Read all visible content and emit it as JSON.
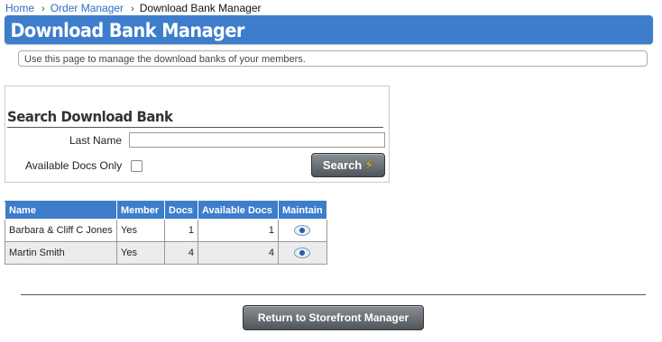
{
  "breadcrumb": {
    "home": "Home",
    "order_manager": "Order Manager",
    "current": "Download Bank Manager"
  },
  "header": {
    "title": "Download Bank Manager"
  },
  "info": {
    "text": "Use this page to manage the download banks of your members."
  },
  "search": {
    "title": "Search Download Bank",
    "last_name_label": "Last Name",
    "last_name_value": "",
    "available_docs_label": "Available Docs Only",
    "available_docs_checked": false,
    "button_label": "Search",
    "button_icon": "lightning-icon"
  },
  "table": {
    "headers": [
      "Name",
      "Member",
      "Docs",
      "Available Docs",
      "Maintain"
    ],
    "rows": [
      {
        "name": "Barbara & Cliff C Jones",
        "member": "Yes",
        "docs": "1",
        "available_docs": "1",
        "maintain_icon": "eye-icon"
      },
      {
        "name": "Martin Smith",
        "member": "Yes",
        "docs": "4",
        "available_docs": "4",
        "maintain_icon": "eye-icon"
      }
    ]
  },
  "footer": {
    "return_label": "Return to Storefront Manager"
  },
  "colors": {
    "accent": "#3d7dcb",
    "link": "#2a6fc4",
    "button": "#5f6469"
  }
}
